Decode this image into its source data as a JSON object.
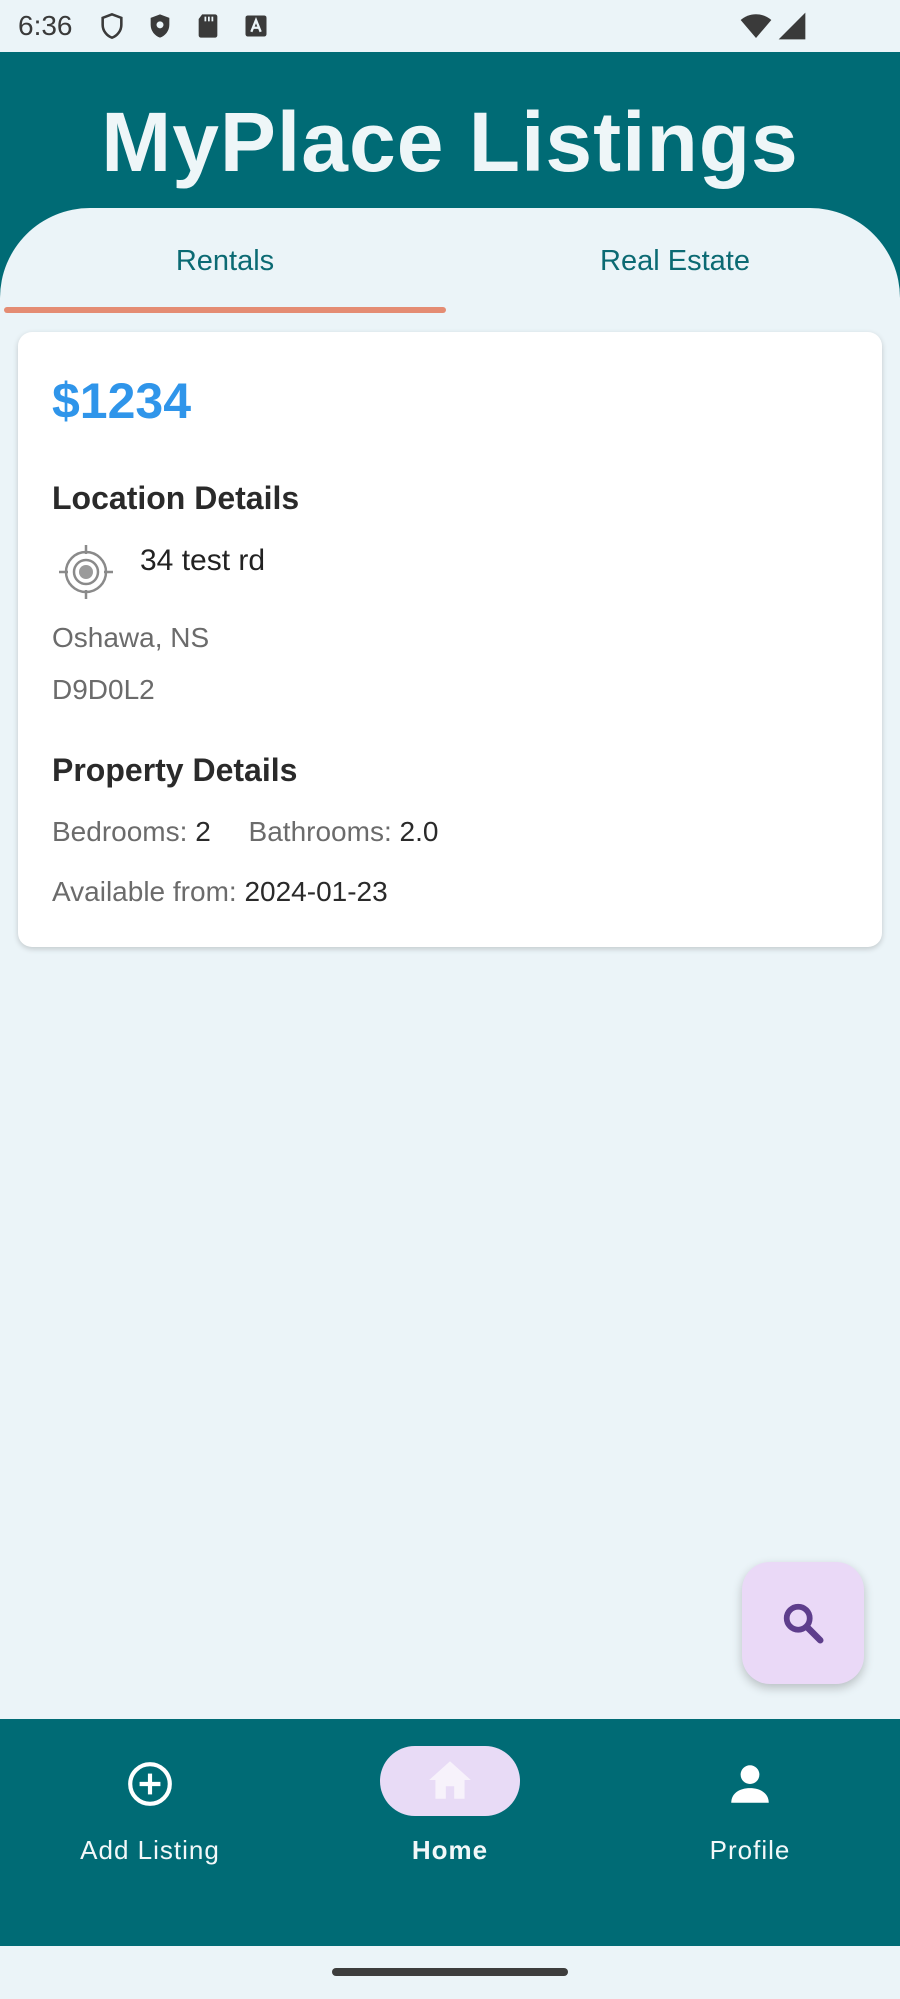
{
  "status_bar": {
    "time": "6:36"
  },
  "app": {
    "title": "MyPlace Listings"
  },
  "tabs": [
    {
      "label": "Rentals",
      "selected": true
    },
    {
      "label": "Real Estate",
      "selected": false
    }
  ],
  "listing": {
    "price": "$1234",
    "location_title": "Location Details",
    "street": "34 test rd",
    "city_province": "Oshawa, NS",
    "postal_code": "D9D0L2",
    "property_title": "Property Details",
    "bedrooms_label": "Bedrooms:",
    "bedrooms_value": "2",
    "bathrooms_label": "Bathrooms:",
    "bathrooms_value": "2.0",
    "available_label": "Available from:",
    "available_value": "2024-01-23"
  },
  "fab": {
    "icon": "search-icon"
  },
  "bottom_nav": [
    {
      "label": "Add Listing",
      "icon": "add-circle-icon",
      "selected": false
    },
    {
      "label": "Home",
      "icon": "home-icon",
      "selected": true
    },
    {
      "label": "Profile",
      "icon": "person-icon",
      "selected": false
    }
  ],
  "colors": {
    "primary": "#006b75",
    "background": "#ebf4f8",
    "price": "#2f95ea",
    "tab_indicator": "#e48c73",
    "fab_background": "#ead9f7"
  }
}
